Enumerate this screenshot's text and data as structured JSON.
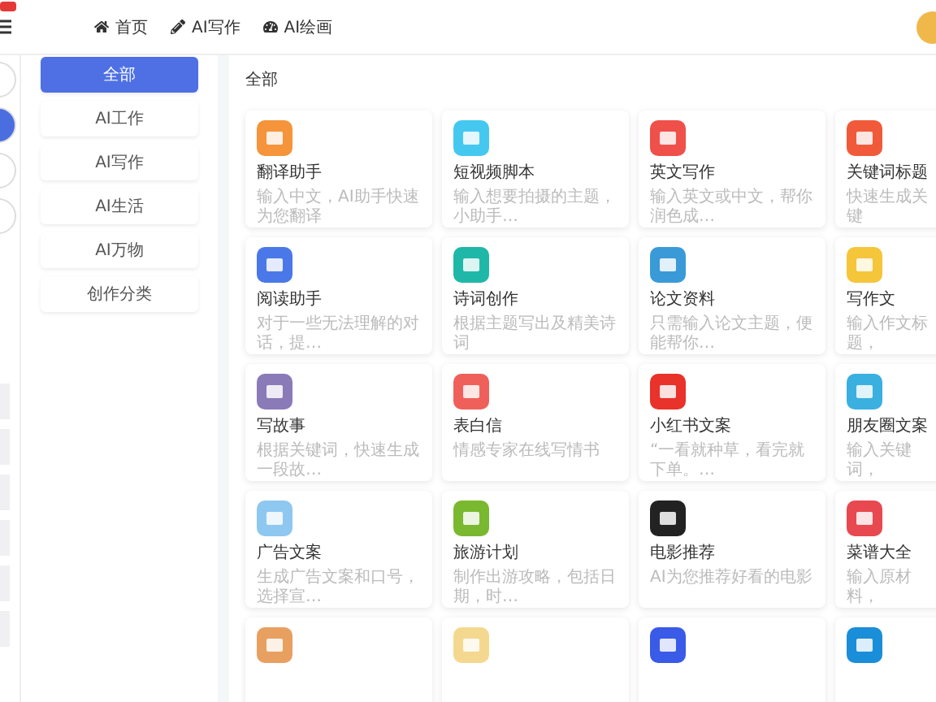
{
  "header": {
    "nav": [
      {
        "label": "首页",
        "kind": "home"
      },
      {
        "label": "AI写作",
        "kind": "pencil"
      },
      {
        "label": "AI绘画",
        "kind": "gauge"
      }
    ]
  },
  "rail": {
    "circles": [
      {
        "selected": false
      },
      {
        "selected": true
      },
      {
        "selected": false
      },
      {
        "selected": false
      }
    ]
  },
  "categories": [
    {
      "label": "全部",
      "selected": true
    },
    {
      "label": "AI工作",
      "selected": false
    },
    {
      "label": "AI写作",
      "selected": false
    },
    {
      "label": "AI生活",
      "selected": false
    },
    {
      "label": "AI万物",
      "selected": false
    },
    {
      "label": "创作分类",
      "selected": false
    }
  ],
  "section_title": "全部",
  "apps": [
    {
      "title": "翻译助手",
      "description": "输入中文，AI助手快速为您翻译",
      "color": "#f5943a"
    },
    {
      "title": "短视频脚本",
      "description": "输入想要拍摄的主题，小助手…",
      "color": "#45c8f0"
    },
    {
      "title": "英文写作",
      "description": "输入英文或中文，帮你润色成…",
      "color": "#f0504a"
    },
    {
      "title": "关键词标题",
      "description": "快速生成关键",
      "color": "#f05a3a"
    },
    {
      "title": "阅读助手",
      "description": "对于一些无法理解的对话，提…",
      "color": "#4a78e8"
    },
    {
      "title": "诗词创作",
      "description": "根据主题写出及精美诗词",
      "color": "#1fb8a8"
    },
    {
      "title": "论文资料",
      "description": "只需输入论文主题，便能帮你…",
      "color": "#3a9ad8"
    },
    {
      "title": "写作文",
      "description": "输入作文标题，",
      "color": "#f5c53a"
    },
    {
      "title": "写故事",
      "description": "根据关键词，快速生成一段故…",
      "color": "#8a7ab8"
    },
    {
      "title": "表白信",
      "description": "情感专家在线写情书",
      "color": "#f0605a"
    },
    {
      "title": "小红书文案",
      "description": "“一看就种草，看完就下单。…",
      "color": "#e8322a"
    },
    {
      "title": "朋友圈文案",
      "description": "输入关键词，",
      "color": "#3ab0e0"
    },
    {
      "title": "广告文案",
      "description": "生成广告文案和口号，选择宣…",
      "color": "#8ec8f0"
    },
    {
      "title": "旅游计划",
      "description": "制作出游攻略，包括日期，时…",
      "color": "#7ab830"
    },
    {
      "title": "电影推荐",
      "description": "AI为您推荐好看的电影",
      "color": "#222222"
    },
    {
      "title": "菜谱大全",
      "description": "输入原材料，",
      "color": "#e84850"
    },
    {
      "color": "#e8a060"
    },
    {
      "color": "#f5d890"
    },
    {
      "color": "#3a5ae8"
    },
    {
      "color": "#1a8ed8"
    }
  ]
}
